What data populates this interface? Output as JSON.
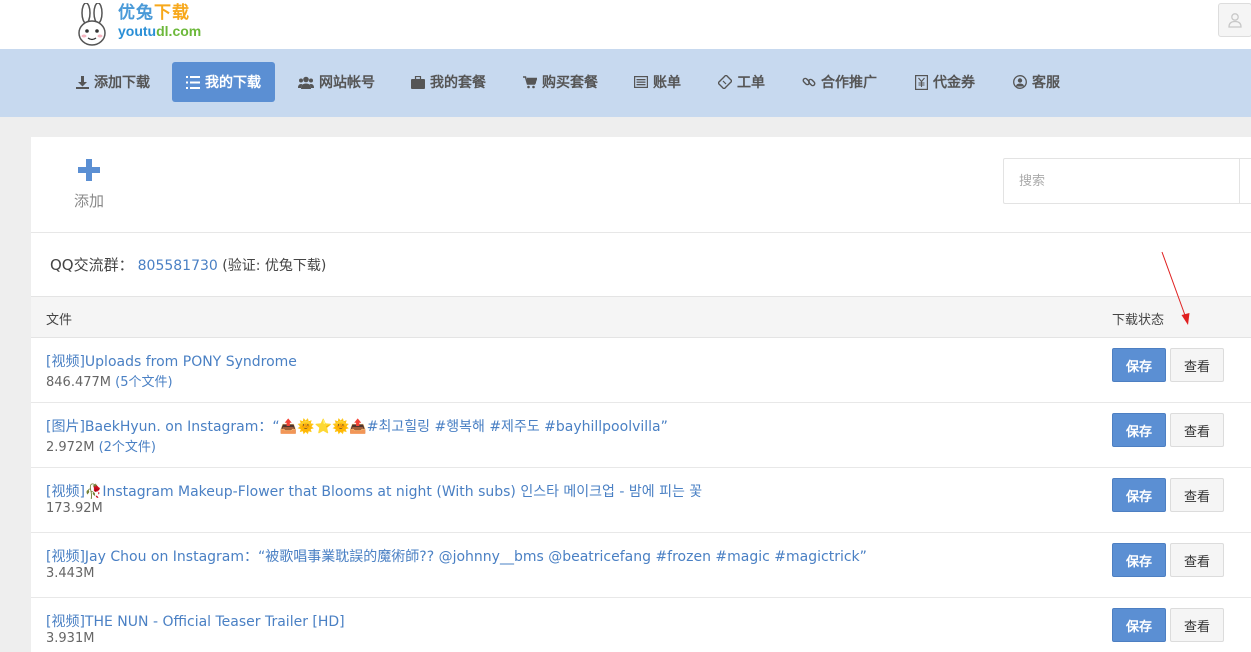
{
  "header": {
    "logo_cn_a": "优兔",
    "logo_cn_b": "下载",
    "logo_en_a": "youtu",
    "logo_en_b": "dl.com",
    "user_icon": "user-icon"
  },
  "nav": [
    {
      "label": "添加下载",
      "icon": "download-icon"
    },
    {
      "label": "我的下载",
      "icon": "list-icon",
      "active": true
    },
    {
      "label": "网站帐号",
      "icon": "users-icon"
    },
    {
      "label": "我的套餐",
      "icon": "briefcase-icon"
    },
    {
      "label": "购买套餐",
      "icon": "cart-icon"
    },
    {
      "label": "账单",
      "icon": "bill-icon"
    },
    {
      "label": "工单",
      "icon": "ticket-icon"
    },
    {
      "label": "合作推广",
      "icon": "link-icon"
    },
    {
      "label": "代金券",
      "icon": "coupon-icon"
    },
    {
      "label": "客服",
      "icon": "support-icon"
    }
  ],
  "toolbar": {
    "add_label": "添加",
    "search_placeholder": "搜索"
  },
  "qq": {
    "label": "QQ交流群：",
    "number": "805581730",
    "verify": "(验证: 优兔下载)"
  },
  "table": {
    "col_file": "文件",
    "col_status": "下载状态",
    "save_label": "保存",
    "view_label": "查看",
    "rows": [
      {
        "title": "[视频]Uploads from PONY Syndrome",
        "size": "846.477M",
        "count": "(5个文件)"
      },
      {
        "title": "[图片]BaekHyun. on Instagram：“📤🌞⭐🌞📤#최고힐링 #행복해 #제주도 #bayhillpoolvilla”",
        "size": "2.972M",
        "count": "(2个文件)"
      },
      {
        "title": "[视频]🥀Instagram Makeup-Flower that Blooms at night (With subs) 인스타 메이크업 - 밤에 피는 꽃",
        "size": "173.92M",
        "count": ""
      },
      {
        "title": "[视频]Jay Chou on Instagram：“被歌唱事業耽誤的魔術師?? @johnny__bms @beatricefang #frozen #magic #magictrick”",
        "size": "3.443M",
        "count": ""
      },
      {
        "title": "[视频]THE NUN - Official Teaser Trailer [HD]",
        "size": "3.931M",
        "count": ""
      }
    ]
  }
}
